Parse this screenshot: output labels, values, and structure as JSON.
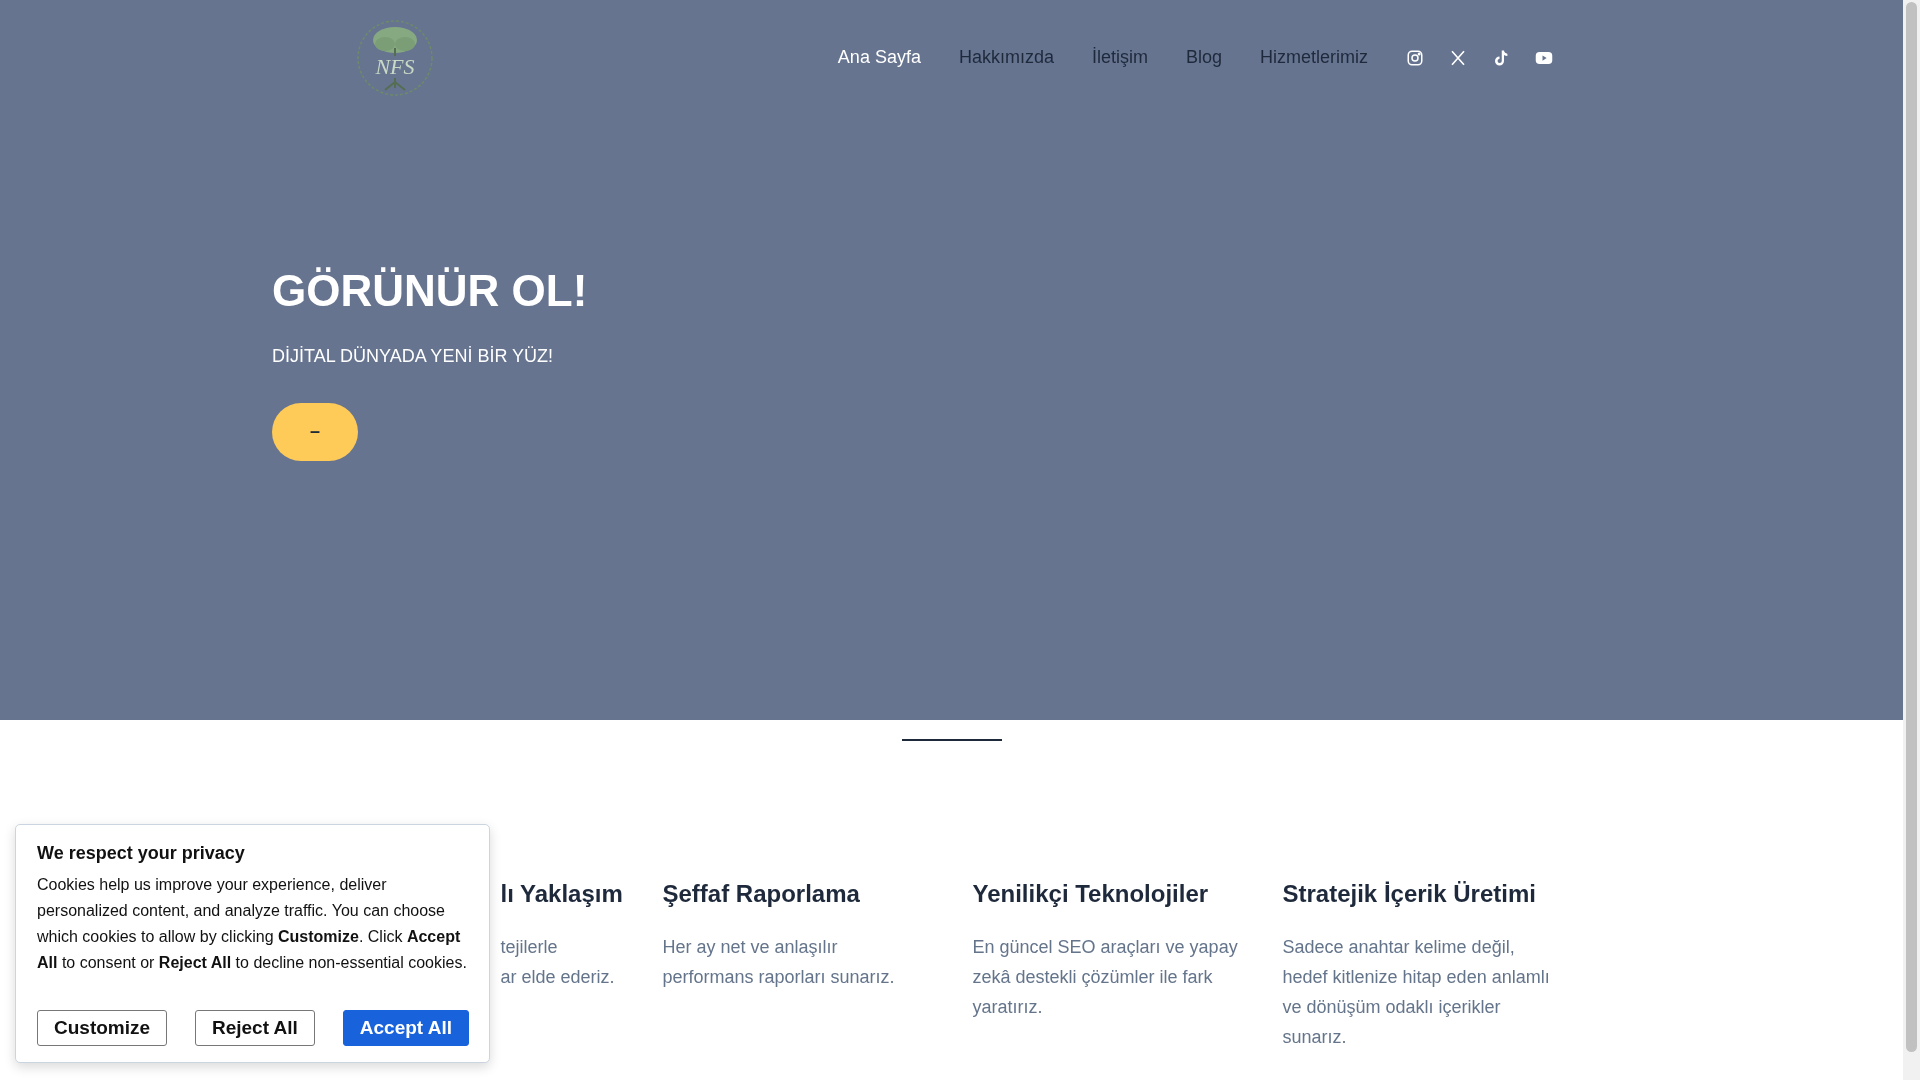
{
  "header": {
    "logo_text": "NFS",
    "nav": [
      {
        "label": "Ana Sayfa",
        "selected": true
      },
      {
        "label": "Hakkımızda",
        "selected": false
      },
      {
        "label": "İletişim",
        "selected": false
      },
      {
        "label": "Blog",
        "selected": false
      },
      {
        "label": "Hizmetlerimiz",
        "selected": false
      }
    ],
    "social": [
      {
        "kind": "instagram"
      },
      {
        "kind": "x"
      },
      {
        "kind": "tiktok"
      },
      {
        "kind": "youtube"
      }
    ]
  },
  "hero": {
    "title": "GÖRÜNÜR OL!",
    "subtitle": "DİJİTAL DÜNYADA YENİ BİR YÜZ!",
    "button": "–"
  },
  "features": [
    {
      "title": "lı Yaklaşım",
      "lines": [
        "tejilerle",
        "ar elde ederiz."
      ]
    },
    {
      "title": "Şeffaf Raporlama",
      "lines": [
        "Her ay net ve anlaşılır performans raporları sunarız."
      ]
    },
    {
      "title": "Yenilikçi Teknolojiler",
      "lines": [
        "En güncel SEO araçları ve yapay zekâ destekli çözümler ile fark yaratırız."
      ]
    },
    {
      "title": "Stratejik İçerik Üretimi",
      "lines": [
        "Sadece anahtar kelime değil, hedef kitlenize hitap eden anlamlı ve dönüşüm odaklı içerikler sunarız."
      ]
    }
  ],
  "cookie": {
    "title": "We respect your privacy",
    "text": "Cookies help us improve your experience, deliver personalized content, and analyze traffic. You can choose which cookies to allow by clicking **Customize**. Click **Accept All** to consent or **Reject All** to decline non-essential cookies.",
    "buttons": [
      {
        "label": "Customize",
        "kind": "secondary"
      },
      {
        "label": "Reject All",
        "kind": "secondary"
      },
      {
        "label": "Accept All",
        "kind": "primary"
      }
    ]
  }
}
